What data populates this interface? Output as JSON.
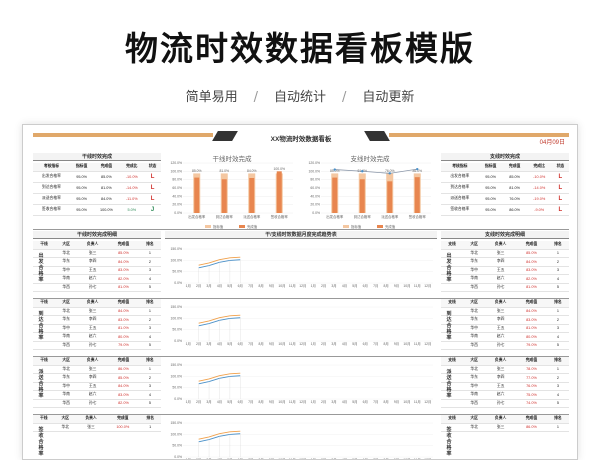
{
  "promo": {
    "title": "物流时效数据看板模版",
    "tags": [
      "简单易用",
      "自动统计",
      "自动更新"
    ],
    "separator": "/"
  },
  "dashboard": {
    "title": "XX物流时效数据看板",
    "date": "04月09日"
  },
  "summary_left": {
    "header": "干线时效完成",
    "columns": [
      "考核指标",
      "指标值",
      "完成值",
      "完成比",
      "状态"
    ],
    "rows": [
      {
        "name": "出发合格率",
        "target": "95.0%",
        "value": "85.0%",
        "ratio": "-10.0%",
        "status": "L",
        "ok": false
      },
      {
        "name": "到达合格率",
        "target": "95.0%",
        "value": "81.0%",
        "ratio": "-14.0%",
        "status": "L",
        "ok": false
      },
      {
        "name": "派送合格率",
        "target": "95.0%",
        "value": "84.0%",
        "ratio": "-11.0%",
        "status": "L",
        "ok": false
      },
      {
        "name": "签收合格率",
        "target": "95.0%",
        "value": "100.0%",
        "ratio": "5.0%",
        "status": "J",
        "ok": true
      }
    ]
  },
  "summary_right": {
    "header": "支线时效完成",
    "columns": [
      "考核指标",
      "指标值",
      "完成值",
      "完成比",
      "状态"
    ],
    "rows": [
      {
        "name": "出发合格率",
        "target": "95.0%",
        "value": "85.0%",
        "ratio": "-10.0%",
        "status": "L",
        "ok": false
      },
      {
        "name": "到达合格率",
        "target": "95.0%",
        "value": "81.0%",
        "ratio": "-14.0%",
        "status": "L",
        "ok": false
      },
      {
        "name": "派送合格率",
        "target": "95.0%",
        "value": "76.0%",
        "ratio": "-19.0%",
        "status": "L",
        "ok": false
      },
      {
        "name": "签收合格率",
        "target": "95.0%",
        "value": "86.0%",
        "ratio": "-9.0%",
        "status": "L",
        "ok": false
      }
    ]
  },
  "chart_data": [
    {
      "type": "bar",
      "title": "干线时效完成",
      "categories": [
        "出发合格率",
        "到达合格率",
        "派送合格率",
        "签收合格率"
      ],
      "series": [
        {
          "name": "指标值",
          "values": [
            95.0,
            95.0,
            95.0,
            95.0
          ]
        },
        {
          "name": "完成值",
          "values": [
            85.0,
            81.0,
            84.0,
            100.0
          ]
        }
      ],
      "ylim": [
        0,
        120
      ],
      "yticks": [
        "0.0%",
        "20.0%",
        "40.0%",
        "60.0%",
        "80.0%",
        "100.0%",
        "120.0%"
      ],
      "data_labels": [
        "85.0%",
        "81.0%",
        "84.0%",
        "100.0%"
      ]
    },
    {
      "type": "bar",
      "title": "支线时效完成",
      "categories": [
        "出发合格率",
        "到达合格率",
        "派送合格率",
        "签收合格率"
      ],
      "series": [
        {
          "name": "指标值",
          "values": [
            95.0,
            95.0,
            95.0,
            95.0
          ]
        },
        {
          "name": "完成值",
          "values": [
            85.0,
            81.0,
            76.0,
            86.0
          ]
        }
      ],
      "ylim": [
        0,
        120
      ],
      "yticks": [
        "0.0%",
        "20.0%",
        "40.0%",
        "60.0%",
        "80.0%",
        "100.0%",
        "120.0%"
      ],
      "data_labels": [
        "85.0%",
        "81.0%",
        "76.0%",
        "86.0%"
      ]
    }
  ],
  "detail_left": {
    "header": "干线时效完成明细",
    "columns": [
      "干线",
      "大区",
      "负责人",
      "完成值",
      "排名"
    ]
  },
  "detail_right": {
    "header": "支线时效完成明细",
    "columns": [
      "支线",
      "大区",
      "负责人",
      "完成值",
      "排名"
    ]
  },
  "trend": {
    "header": "干/支线时效数据月度完成趋势表"
  },
  "bands": [
    {
      "label": "出发合格率",
      "rows": [
        {
          "region": "华北",
          "owner": "张三",
          "value": "85.0%",
          "rank": "1"
        },
        {
          "region": "华东",
          "owner": "李四",
          "value": "84.0%",
          "rank": "2"
        },
        {
          "region": "华中",
          "owner": "王五",
          "value": "83.0%",
          "rank": "3"
        },
        {
          "region": "华南",
          "owner": "赵六",
          "value": "82.0%",
          "rank": "4"
        },
        {
          "region": "华西",
          "owner": "孙七",
          "value": "81.0%",
          "rank": "5"
        }
      ],
      "right_rows": [
        {
          "region": "华北",
          "owner": "张三",
          "value": "85.0%",
          "rank": "1"
        },
        {
          "region": "华东",
          "owner": "李四",
          "value": "84.0%",
          "rank": "2"
        },
        {
          "region": "华中",
          "owner": "王五",
          "value": "83.0%",
          "rank": "3"
        },
        {
          "region": "华南",
          "owner": "赵六",
          "value": "82.0%",
          "rank": "4"
        },
        {
          "region": "华西",
          "owner": "孙七",
          "value": "81.0%",
          "rank": "5"
        }
      ]
    },
    {
      "label": "到达合格率",
      "rows": [
        {
          "region": "华北",
          "owner": "张三",
          "value": "84.0%",
          "rank": "1"
        },
        {
          "region": "华东",
          "owner": "李四",
          "value": "83.0%",
          "rank": "2"
        },
        {
          "region": "华中",
          "owner": "王五",
          "value": "81.0%",
          "rank": "3"
        },
        {
          "region": "华南",
          "owner": "赵六",
          "value": "80.0%",
          "rank": "4"
        },
        {
          "region": "华西",
          "owner": "孙七",
          "value": "79.0%",
          "rank": "5"
        }
      ],
      "right_rows": [
        {
          "region": "华北",
          "owner": "张三",
          "value": "84.0%",
          "rank": "1"
        },
        {
          "region": "华东",
          "owner": "李四",
          "value": "83.0%",
          "rank": "2"
        },
        {
          "region": "华中",
          "owner": "王五",
          "value": "81.0%",
          "rank": "3"
        },
        {
          "region": "华南",
          "owner": "赵六",
          "value": "80.0%",
          "rank": "4"
        },
        {
          "region": "华西",
          "owner": "孙七",
          "value": "79.0%",
          "rank": "5"
        }
      ]
    },
    {
      "label": "派送合格率",
      "rows": [
        {
          "region": "华北",
          "owner": "张三",
          "value": "86.0%",
          "rank": "1"
        },
        {
          "region": "华东",
          "owner": "李四",
          "value": "85.0%",
          "rank": "2"
        },
        {
          "region": "华中",
          "owner": "王五",
          "value": "84.0%",
          "rank": "3"
        },
        {
          "region": "华南",
          "owner": "赵六",
          "value": "83.0%",
          "rank": "4"
        },
        {
          "region": "华西",
          "owner": "孙七",
          "value": "82.0%",
          "rank": "5"
        }
      ],
      "right_rows": [
        {
          "region": "华北",
          "owner": "张三",
          "value": "78.0%",
          "rank": "1"
        },
        {
          "region": "华东",
          "owner": "李四",
          "value": "77.0%",
          "rank": "2"
        },
        {
          "region": "华中",
          "owner": "王五",
          "value": "76.0%",
          "rank": "3"
        },
        {
          "region": "华南",
          "owner": "赵六",
          "value": "75.0%",
          "rank": "4"
        },
        {
          "region": "华西",
          "owner": "孙七",
          "value": "74.0%",
          "rank": "5"
        }
      ]
    },
    {
      "label": "签收合格率",
      "rows": [
        {
          "region": "华北",
          "owner": "张三",
          "value": "100.0%",
          "rank": "1"
        }
      ],
      "right_rows": [
        {
          "region": "华北",
          "owner": "张三",
          "value": "86.0%",
          "rank": "1"
        }
      ]
    }
  ],
  "trend_months": [
    "1月",
    "2月",
    "3月",
    "4月",
    "5月",
    "6月",
    "7月",
    "8月",
    "9月",
    "10月",
    "11月",
    "12月"
  ],
  "trend_yticks": [
    "150.0%",
    "100.0%",
    "50.0%",
    "0.0%"
  ],
  "colors": {
    "accent": "#e0a86a",
    "bar_target": "#f4c7a1",
    "bar_actual": "#e8864f",
    "line_orange": "#f0a04b",
    "line_blue": "#4a90c8",
    "status_bad": "#d0312d",
    "status_good": "#2e8b57"
  }
}
